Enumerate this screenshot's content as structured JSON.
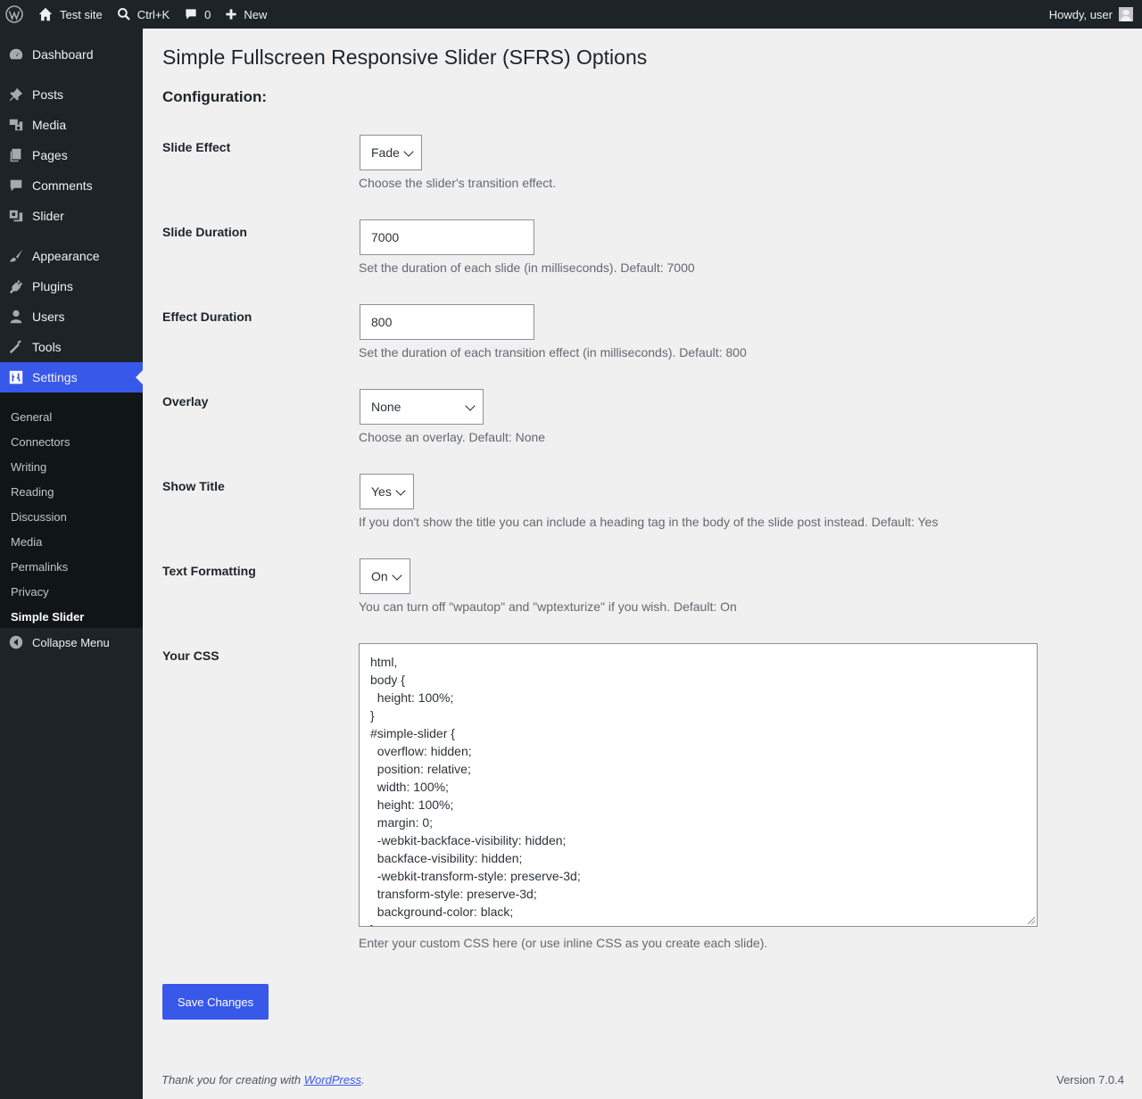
{
  "admin_bar": {
    "site_name": "Test site",
    "search_shortcut": "Ctrl+K",
    "comments_count": "0",
    "new_label": "New",
    "greeting": "Howdy, user"
  },
  "sidebar": {
    "items": [
      {
        "label": "Dashboard",
        "icon": "dashboard-icon"
      },
      {
        "label": "Posts",
        "icon": "pin-icon"
      },
      {
        "label": "Media",
        "icon": "media-icon"
      },
      {
        "label": "Pages",
        "icon": "pages-icon"
      },
      {
        "label": "Comments",
        "icon": "comment-icon"
      },
      {
        "label": "Slider",
        "icon": "slides-icon"
      },
      {
        "label": "Appearance",
        "icon": "paintbrush-icon"
      },
      {
        "label": "Plugins",
        "icon": "plugin-icon"
      },
      {
        "label": "Users",
        "icon": "user-icon"
      },
      {
        "label": "Tools",
        "icon": "wrench-icon"
      },
      {
        "label": "Settings",
        "icon": "settings-icon"
      }
    ],
    "submenu": [
      "General",
      "Connectors",
      "Writing",
      "Reading",
      "Discussion",
      "Media",
      "Permalinks",
      "Privacy",
      "Simple Slider"
    ],
    "collapse_label": "Collapse Menu"
  },
  "page": {
    "title": "Simple Fullscreen Responsive Slider (SFRS) Options",
    "section": "Configuration:"
  },
  "fields": {
    "slide_effect": {
      "label": "Slide Effect",
      "value": "Fade",
      "desc": "Choose the slider's transition effect."
    },
    "slide_duration": {
      "label": "Slide Duration",
      "value": "7000",
      "desc": "Set the duration of each slide (in milliseconds). Default: 7000"
    },
    "effect_duration": {
      "label": "Effect Duration",
      "value": "800",
      "desc": "Set the duration of each transition effect (in milliseconds). Default: 800"
    },
    "overlay": {
      "label": "Overlay",
      "value": "None",
      "desc": "Choose an overlay. Default: None"
    },
    "show_title": {
      "label": "Show Title",
      "value": "Yes",
      "desc": "If you don't show the title you can include a heading tag in the body of the slide post instead. Default: Yes"
    },
    "text_formatting": {
      "label": "Text Formatting",
      "value": "On",
      "desc": "You can turn off \"wpautop\" and \"wptexturize\" if you wish. Default: On"
    },
    "your_css": {
      "label": "Your CSS",
      "value": "html,\nbody {\n  height: 100%;\n}\n#simple-slider {\n  overflow: hidden;\n  position: relative;\n  width: 100%;\n  height: 100%;\n  margin: 0;\n  -webkit-backface-visibility: hidden;\n  backface-visibility: hidden;\n  -webkit-transform-style: preserve-3d;\n  transform-style: preserve-3d;\n  background-color: black;\n}",
      "desc": "Enter your custom CSS here (or use inline CSS as you create each slide)."
    }
  },
  "save_label": "Save Changes",
  "footer": {
    "thanks_prefix": "Thank you for creating with ",
    "thanks_link": "WordPress",
    "thanks_suffix": ".",
    "version": "Version 7.0.4"
  },
  "colors": {
    "accent": "#3858e9",
    "sidebar_bg": "#1d2327",
    "content_bg": "#f0f0f1"
  }
}
